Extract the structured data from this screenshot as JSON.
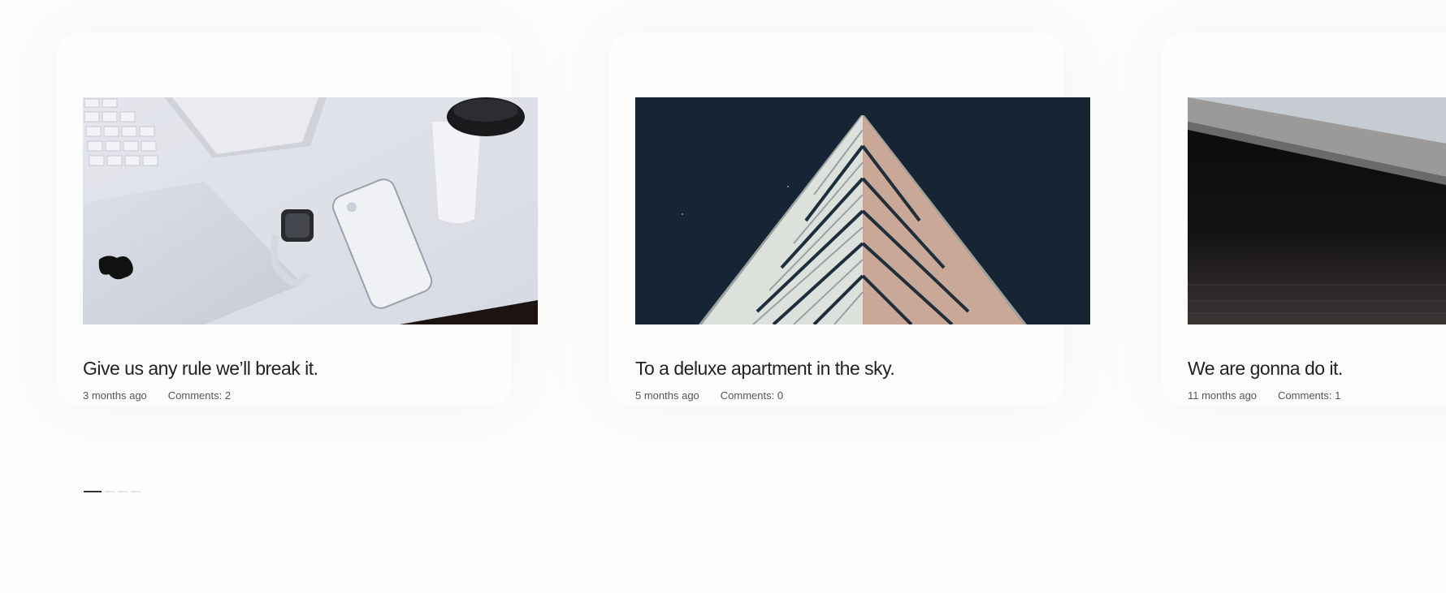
{
  "posts": [
    {
      "title": "Give us any rule we’ll break it.",
      "time": "3 months ago",
      "comments": "Comments: 2",
      "image_icon": "desk-devices-photo"
    },
    {
      "title": "To a deluxe apartment in the sky.",
      "time": "5 months ago",
      "comments": "Comments: 0",
      "image_icon": "skyscraper-photo"
    },
    {
      "title": "We are gonna do it.",
      "time": "11 months ago",
      "comments": "Comments: 1",
      "image_icon": "dark-desk-photo"
    }
  ],
  "pagination": {
    "total": 4,
    "active": 1
  },
  "colors": {
    "background": "#fdfdfd",
    "title": "#222222",
    "meta": "#555555",
    "pagination_active": "#333333",
    "pagination_inactive": "#e4e4e4"
  }
}
